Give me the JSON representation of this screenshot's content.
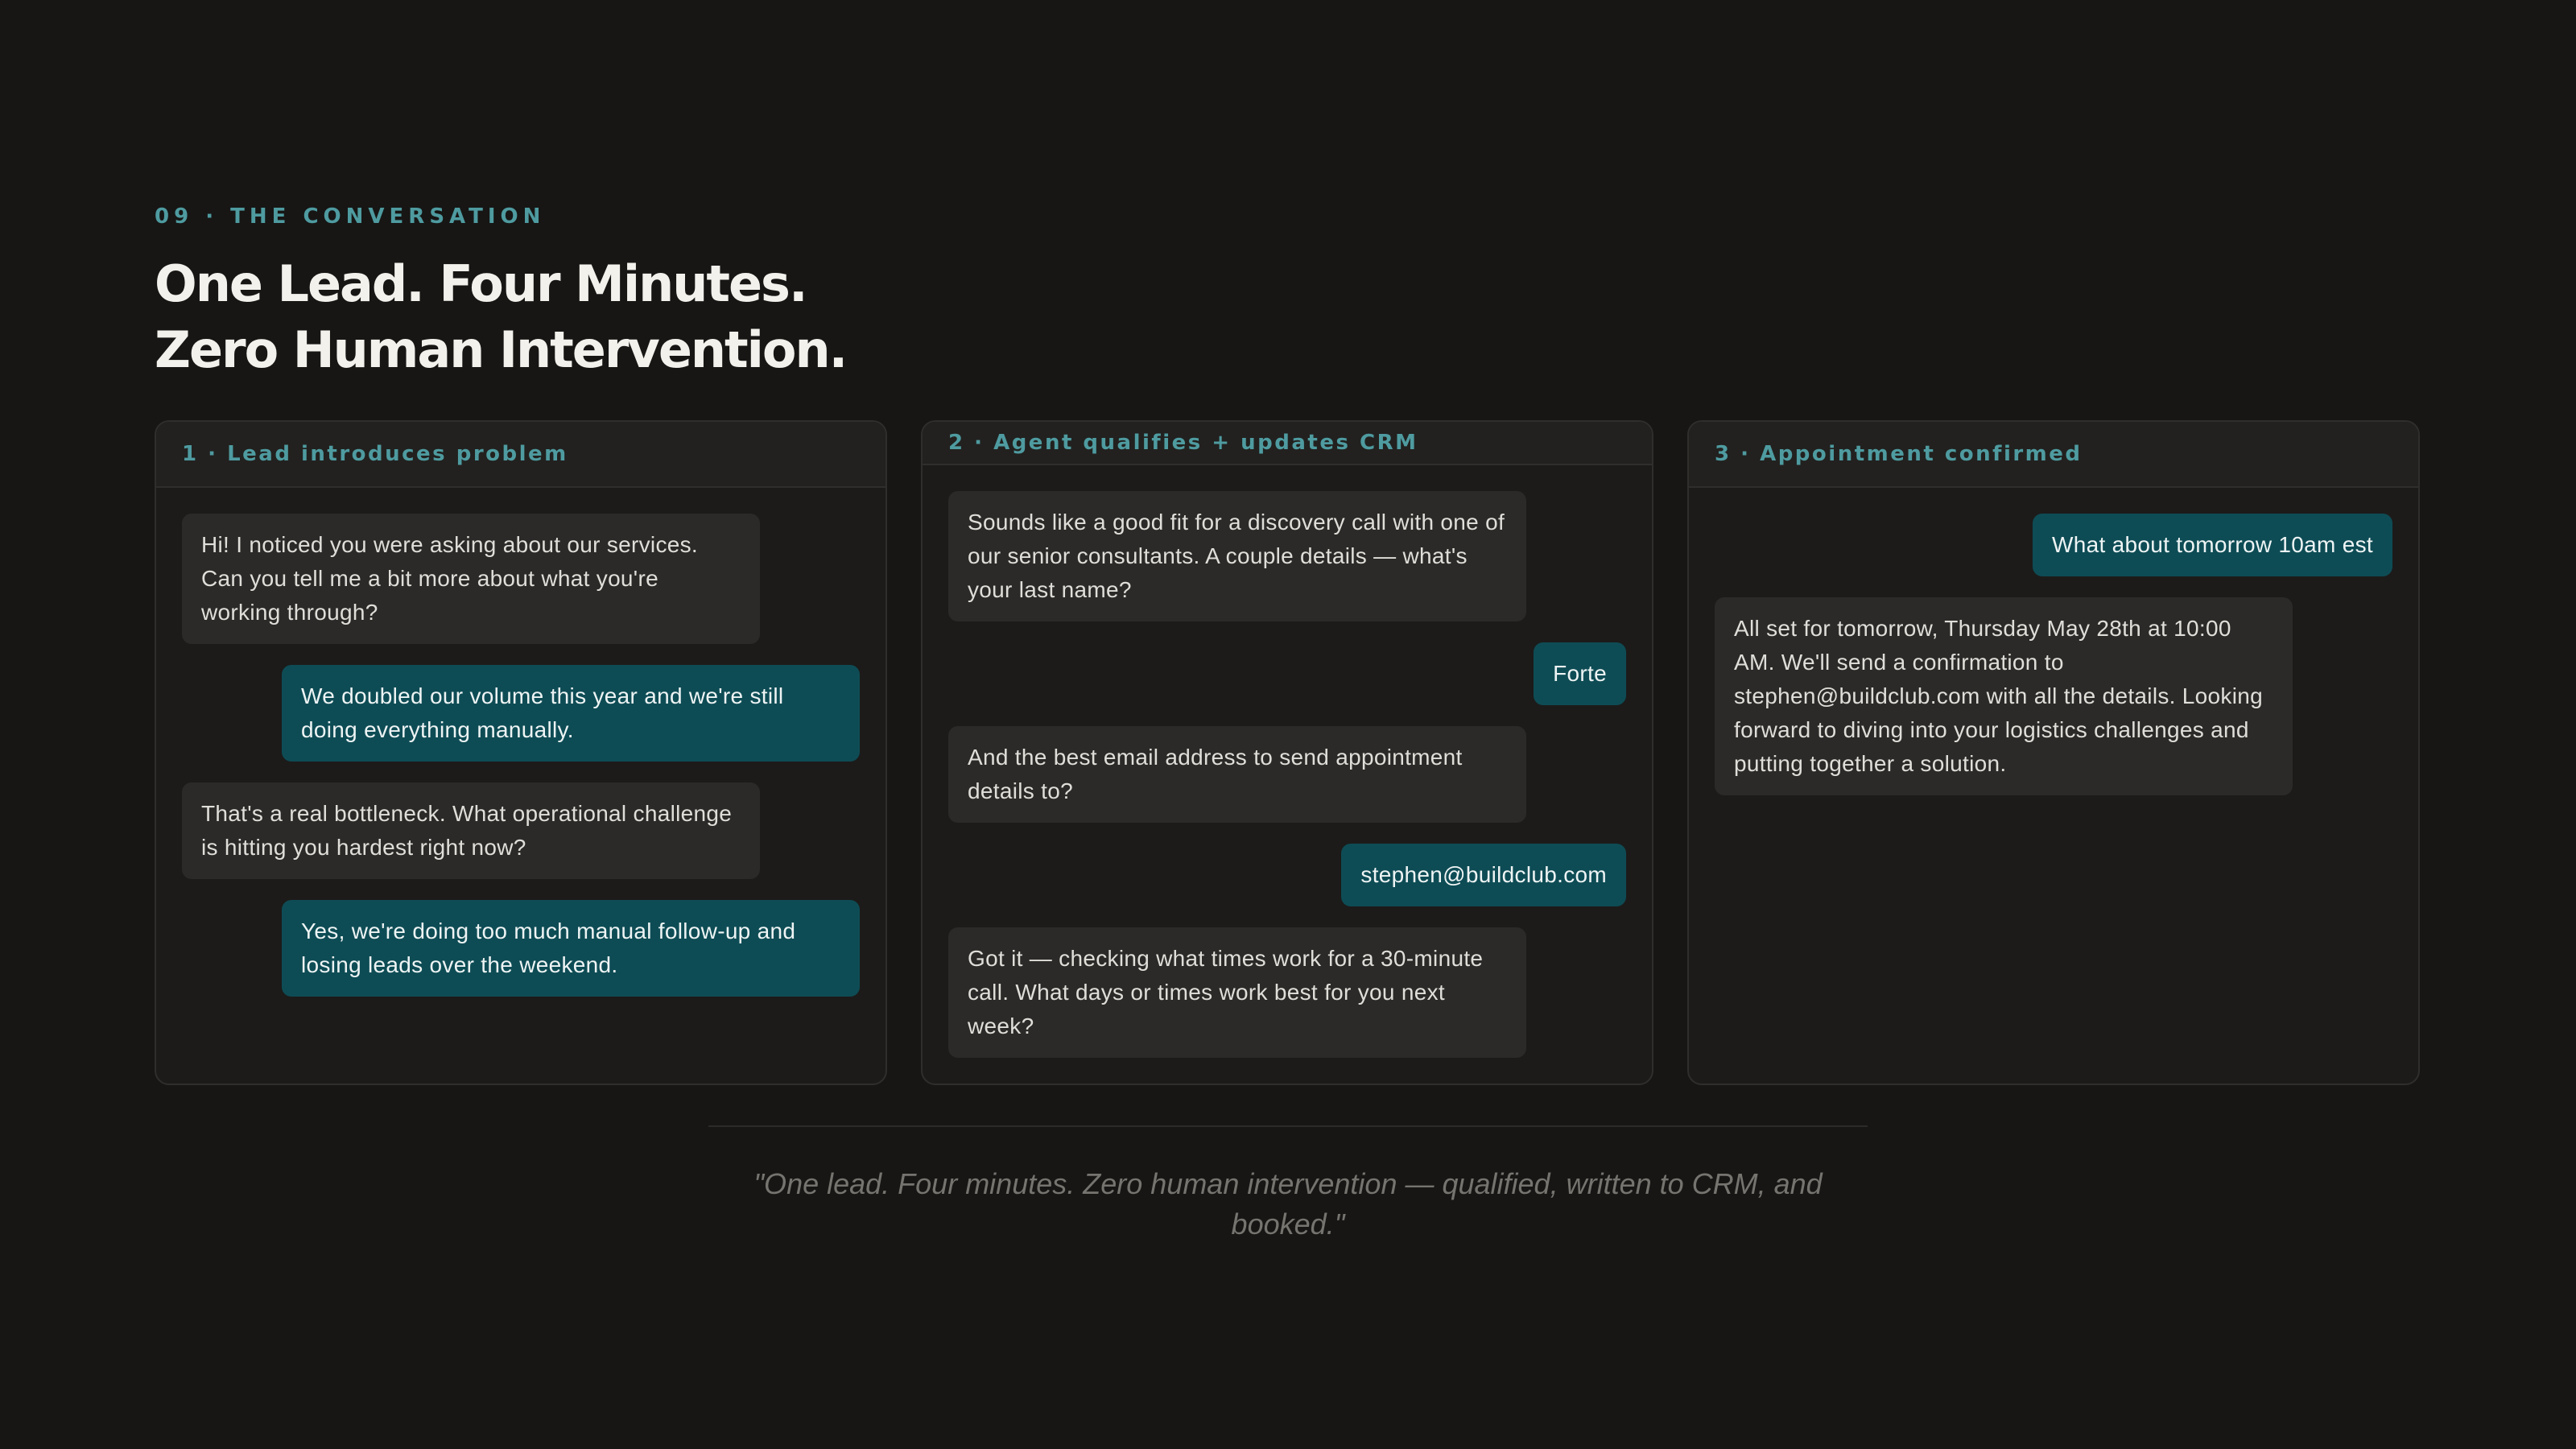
{
  "header": {
    "eyebrow": "09 · THE CONVERSATION",
    "title_line1": "One Lead. Four Minutes.",
    "title_line2": "Zero Human Intervention."
  },
  "panels": [
    {
      "title": "1 · Lead introduces problem",
      "messages": [
        {
          "role": "agent",
          "text": "Hi! I noticed you were asking about our services. Can you tell me a bit more about what you're working through?"
        },
        {
          "role": "lead",
          "text": "We doubled our volume this year and we're still doing everything manually."
        },
        {
          "role": "agent",
          "text": "That's a real bottleneck. What operational challenge is hitting you hardest right now?"
        },
        {
          "role": "lead",
          "text": "Yes, we're doing too much manual follow-up and losing leads over the weekend."
        }
      ]
    },
    {
      "title": "2 · Agent qualifies + updates CRM",
      "messages": [
        {
          "role": "agent",
          "text": "Sounds like a good fit for a discovery call with one of our senior consultants. A couple details — what's your last name?"
        },
        {
          "role": "lead",
          "text": "Forte"
        },
        {
          "role": "agent",
          "text": "And the best email address to send appointment details to?"
        },
        {
          "role": "lead",
          "text": "stephen@buildclub.com"
        },
        {
          "role": "agent",
          "text": "Got it — checking what times work for a 30-minute call. What days or times work best for you next week?"
        }
      ]
    },
    {
      "title": "3 · Appointment confirmed",
      "messages": [
        {
          "role": "lead",
          "text": "What about tomorrow 10am est"
        },
        {
          "role": "agent",
          "text": "All set for tomorrow, Thursday May 28th at 10:00 AM. We'll send a confirmation to stephen@buildclub.com with all the details. Looking forward to diving into your logistics challenges and putting together a solution."
        }
      ]
    }
  ],
  "quote": "\"One lead. Four minutes. Zero human intervention — qualified, written to CRM, and booked.\"",
  "colors": {
    "background": "#171615",
    "accent": "#4e9ba0",
    "lead_bubble": "#0e4c55",
    "agent_bubble": "#2b2a28"
  }
}
